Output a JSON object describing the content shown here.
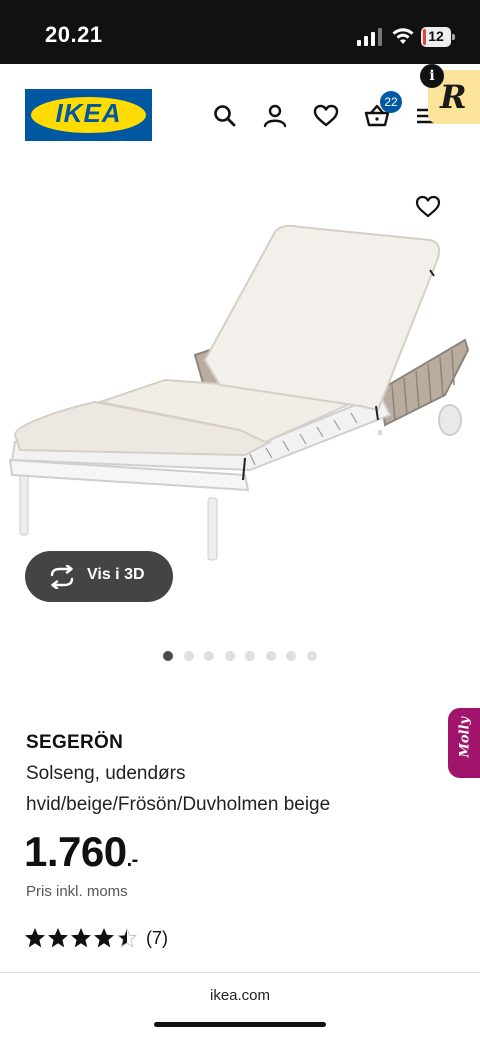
{
  "status_bar": {
    "time": "20.21",
    "battery": "12",
    "battery_level": 0.12,
    "icons": [
      "signal-icon",
      "wifi-icon",
      "battery-icon"
    ]
  },
  "header": {
    "logo_text": "IKEA",
    "cart_count": "22",
    "icons": [
      "search-icon",
      "user-icon",
      "heart-icon",
      "cart-icon",
      "menu-icon"
    ],
    "colors": {
      "brand_blue": "#0058a3",
      "brand_yellow": "#ffdb00"
    }
  },
  "extensions": {
    "reader_letter": "R",
    "molly_label": "Molly",
    "info_label": "i"
  },
  "gallery": {
    "vis_3d_label": "Vis i 3D",
    "dot_count": 8,
    "active_dot": 0
  },
  "product": {
    "name": "SEGERÖN",
    "description": "Solseng, udendørs",
    "variant": "hvid/beige/Frösön/Duvholmen beige",
    "price": "1.760",
    "price_suffix": ".-",
    "vat_note": "Pris inkl. moms",
    "rating": 4.5,
    "rating_max": 5,
    "review_count": "(7)"
  },
  "browser": {
    "url": "ikea.com"
  }
}
